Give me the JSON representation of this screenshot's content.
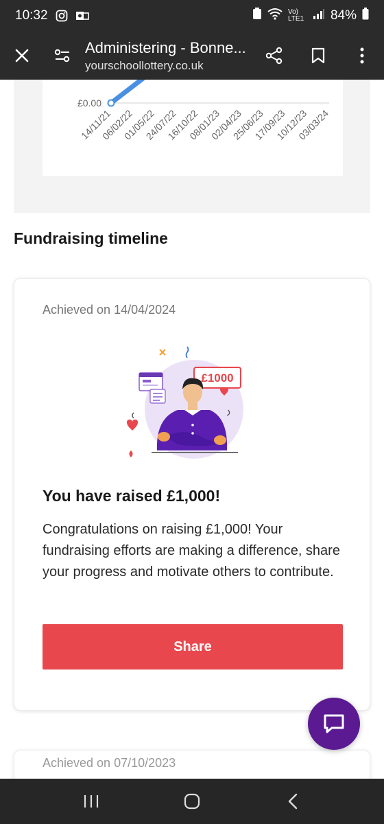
{
  "status_bar": {
    "time": "10:32",
    "battery": "84%",
    "network": "Vo) LTE1"
  },
  "toolbar": {
    "title": "Administering - Bonne...",
    "url": "yourschoollottery.co.uk"
  },
  "chart_data": {
    "type": "line",
    "y_tick_label": "£0.00",
    "categories": [
      "14/11/21",
      "06/02/22",
      "01/05/22",
      "24/07/22",
      "16/10/22",
      "08/01/23",
      "02/04/23",
      "25/06/23",
      "17/09/23",
      "10/12/23",
      "03/03/24"
    ],
    "series_color": "#4a90e2"
  },
  "section_title": "Fundraising timeline",
  "card": {
    "achieved": "Achieved on 14/04/2024",
    "badge_text": "£1000",
    "heading": "You have raised £1,000!",
    "body": "Congratulations on raising £1,000! Your fundraising efforts are making a difference, share your progress and motivate others to contribute.",
    "share_label": "Share"
  },
  "next_card": {
    "achieved_partial": "Achieved on 07/10/2023"
  },
  "colors": {
    "share": "#e9474e",
    "chat_fab": "#5b1a91",
    "bar": "#2b2b2b"
  }
}
